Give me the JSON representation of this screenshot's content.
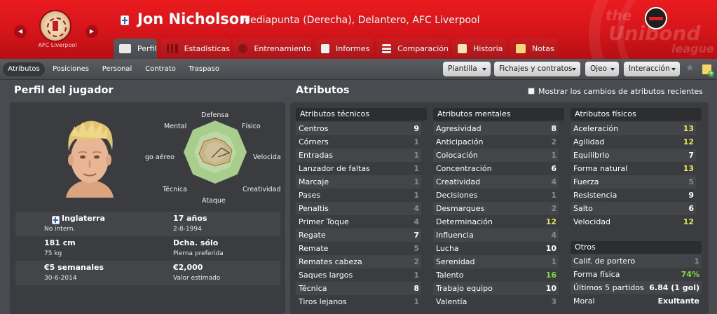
{
  "colors": {
    "brand_red": "#d4151a",
    "panel_bg": "#3a3c3f",
    "value_white": "#ffffff",
    "value_gray": "#8a8a8a",
    "value_yellow": "#e7e35d",
    "value_green": "#7ed84c"
  },
  "header": {
    "club_name": "AFC Liverpool",
    "player_name": "Jon Nicholson",
    "player_subtitle": "Mediapunta (Derecha), Delantero, AFC Liverpool",
    "nav_prev_icon": "triangle-left-icon",
    "nav_next_icon": "triangle-right-icon",
    "brand_text_1": "the",
    "brand_text_2": "Unibond",
    "brand_text_3": "league",
    "tabs": [
      {
        "label": "Perfil",
        "icon": "profile-card-icon",
        "active": true
      },
      {
        "label": "Estadísticas",
        "icon": "bar-chart-icon",
        "active": false
      },
      {
        "label": "Entrenamiento",
        "icon": "whistle-icon",
        "active": false
      },
      {
        "label": "Informes",
        "icon": "document-icon",
        "active": false
      },
      {
        "label": "Comparación",
        "icon": "compare-icon",
        "active": false
      },
      {
        "label": "Historia",
        "icon": "book-icon",
        "active": false
      },
      {
        "label": "Notas",
        "icon": "notepad-icon",
        "active": false
      }
    ]
  },
  "subnav": {
    "items": [
      {
        "label": "Atributos",
        "active": true
      },
      {
        "label": "Posiciones",
        "active": false
      },
      {
        "label": "Personal",
        "active": false
      },
      {
        "label": "Contrato",
        "active": false
      },
      {
        "label": "Traspaso",
        "active": false
      }
    ],
    "dropdowns": [
      {
        "label": "Plantilla"
      },
      {
        "label": "Fichajes y contratos"
      },
      {
        "label": "Ojeo"
      },
      {
        "label": "Interacción"
      }
    ]
  },
  "profile": {
    "title": "Perfil del jugador",
    "radar": {
      "labels": {
        "defensa": "Defensa",
        "fisico": "Físico",
        "velocidad": "Velocida",
        "creatividad": "Creatividad",
        "ataque": "Ataque",
        "tecnica": "Técnica",
        "juego_aereo": "go aéreo",
        "mental": "Mental"
      }
    },
    "info": {
      "nationality": "Inglaterra",
      "intl_status": "No intern.",
      "age": "17 años",
      "dob": "2-8-1994",
      "height": "181 cm",
      "weight": "75 kg",
      "foot": "Dcha. sólo",
      "foot_label": "Pierna preferida",
      "wage": "€5 semanales",
      "contract_end": "30-6-2014",
      "value": "€2,000",
      "value_label": "Valor estimado"
    }
  },
  "attributes": {
    "title": "Atributos",
    "show_changes_label": "Mostrar los cambios de atributos recientes",
    "technical": {
      "header": "Atributos técnicos",
      "rows": [
        {
          "name": "Centros",
          "value": "9"
        },
        {
          "name": "Córners",
          "value": "1"
        },
        {
          "name": "Entradas",
          "value": "1"
        },
        {
          "name": "Lanzador de faltas",
          "value": "1"
        },
        {
          "name": "Marcaje",
          "value": "1"
        },
        {
          "name": "Pases",
          "value": "1"
        },
        {
          "name": "Penaltis",
          "value": "4"
        },
        {
          "name": "Primer Toque",
          "value": "4"
        },
        {
          "name": "Regate",
          "value": "7"
        },
        {
          "name": "Remate",
          "value": "5"
        },
        {
          "name": "Remates cabeza",
          "value": "2"
        },
        {
          "name": "Saques largos",
          "value": "1"
        },
        {
          "name": "Técnica",
          "value": "8"
        },
        {
          "name": "Tiros lejanos",
          "value": "1"
        }
      ]
    },
    "mental": {
      "header": "Atributos mentales",
      "rows": [
        {
          "name": "Agresividad",
          "value": "8"
        },
        {
          "name": "Anticipación",
          "value": "2"
        },
        {
          "name": "Colocación",
          "value": "1"
        },
        {
          "name": "Concentración",
          "value": "6"
        },
        {
          "name": "Creatividad",
          "value": "4"
        },
        {
          "name": "Decisiones",
          "value": "1"
        },
        {
          "name": "Desmarques",
          "value": "2"
        },
        {
          "name": "Determinación",
          "value": "12"
        },
        {
          "name": "Influencia",
          "value": "4"
        },
        {
          "name": "Lucha",
          "value": "10"
        },
        {
          "name": "Serenidad",
          "value": "1"
        },
        {
          "name": "Talento",
          "value": "16"
        },
        {
          "name": "Trabajo equipo",
          "value": "10"
        },
        {
          "name": "Valentía",
          "value": "3"
        }
      ]
    },
    "physical": {
      "header": "Atributos físicos",
      "rows": [
        {
          "name": "Aceleración",
          "value": "13"
        },
        {
          "name": "Agilidad",
          "value": "12"
        },
        {
          "name": "Equilibrio",
          "value": "7"
        },
        {
          "name": "Forma natural",
          "value": "13"
        },
        {
          "name": "Fuerza",
          "value": "5"
        },
        {
          "name": "Resistencia",
          "value": "9"
        },
        {
          "name": "Salto",
          "value": "6"
        },
        {
          "name": "Velocidad",
          "value": "12"
        }
      ]
    },
    "other": {
      "header": "Otros",
      "rows": [
        {
          "name": "Calif. de portero",
          "value": "1"
        },
        {
          "name": "Forma física",
          "value": "74%"
        },
        {
          "name": "Últimos 5 partidos",
          "value": "6.84 (1 gol)"
        },
        {
          "name": "Moral",
          "value": "Exultante"
        }
      ]
    }
  }
}
